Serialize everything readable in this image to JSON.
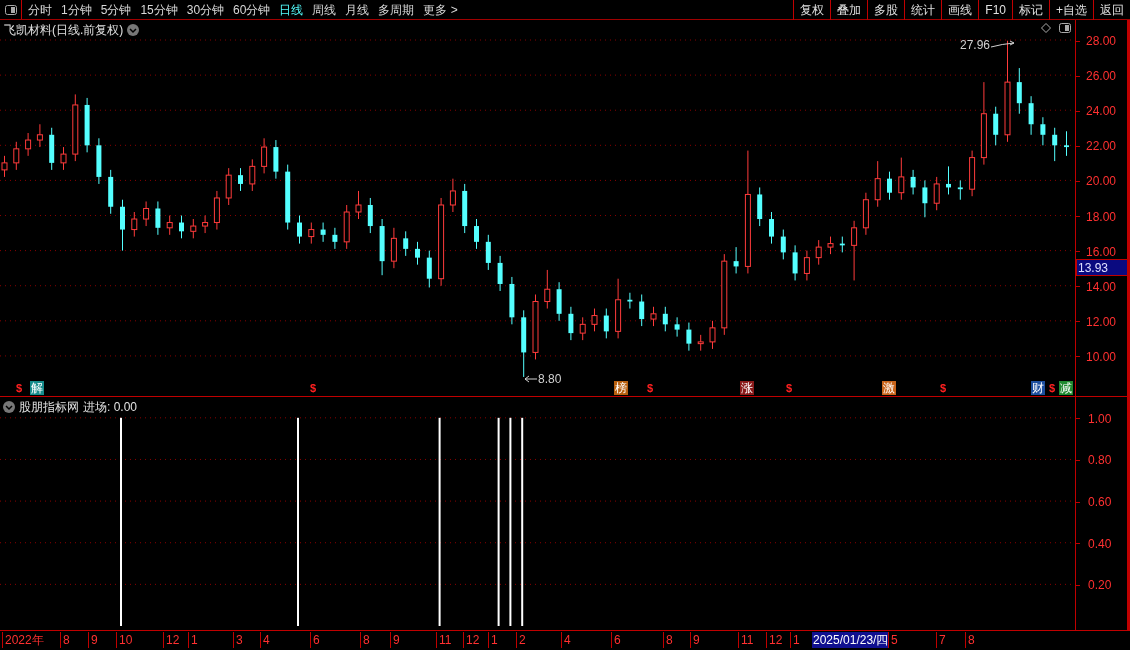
{
  "toolbar": {
    "period_tabs": [
      {
        "label": "分时",
        "selected": false
      },
      {
        "label": "1分钟",
        "selected": false
      },
      {
        "label": "5分钟",
        "selected": false
      },
      {
        "label": "15分钟",
        "selected": false
      },
      {
        "label": "30分钟",
        "selected": false
      },
      {
        "label": "60分钟",
        "selected": false
      },
      {
        "label": "日线",
        "selected": true
      },
      {
        "label": "周线",
        "selected": false
      },
      {
        "label": "月线",
        "selected": false
      },
      {
        "label": "多周期",
        "selected": false
      },
      {
        "label": "更多 >",
        "selected": false
      }
    ],
    "actions": [
      "复权",
      "叠加",
      "多股",
      "统计",
      "画线",
      "F10",
      "标记",
      "+自选",
      "返回"
    ]
  },
  "price_chart": {
    "title": "飞凯材料(日线.前复权)",
    "current_price": "13.93",
    "high_label": "27.96",
    "low_label": "8.80",
    "chart_data": {
      "type": "candlestick",
      "ylim": [
        7.66,
        29.14
      ],
      "grid": true,
      "yticks": [
        {
          "value": 28,
          "label": "28.00"
        },
        {
          "value": 26,
          "label": "26.00"
        },
        {
          "value": 24,
          "label": "24.00"
        },
        {
          "value": 22,
          "label": "22.00"
        },
        {
          "value": 20,
          "label": "20.00"
        },
        {
          "value": 18,
          "label": "18.00"
        },
        {
          "value": 16,
          "label": "16.00"
        },
        {
          "value": 14,
          "label": "14.00"
        },
        {
          "value": 12,
          "label": "12.00"
        },
        {
          "value": 10,
          "label": "10.00"
        }
      ],
      "ohlc": [
        [
          20.6,
          21.4,
          20.2,
          21.0
        ],
        [
          21.0,
          22.2,
          20.6,
          21.8
        ],
        [
          21.8,
          22.7,
          21.4,
          22.3
        ],
        [
          22.3,
          23.2,
          21.9,
          22.6
        ],
        [
          22.6,
          23.0,
          20.6,
          21.0
        ],
        [
          21.0,
          21.9,
          20.6,
          21.5
        ],
        [
          21.5,
          24.9,
          21.1,
          24.3
        ],
        [
          24.3,
          24.7,
          21.6,
          22.0
        ],
        [
          22.0,
          22.4,
          19.8,
          20.2
        ],
        [
          20.2,
          20.6,
          18.1,
          18.5
        ],
        [
          18.5,
          18.9,
          16.0,
          17.2
        ],
        [
          17.2,
          18.2,
          16.8,
          17.8
        ],
        [
          17.8,
          18.8,
          17.4,
          18.4
        ],
        [
          18.4,
          18.8,
          16.9,
          17.3
        ],
        [
          17.3,
          18.0,
          16.9,
          17.6
        ],
        [
          17.6,
          18.0,
          16.7,
          17.1
        ],
        [
          17.1,
          17.8,
          16.7,
          17.4
        ],
        [
          17.4,
          18.0,
          17.0,
          17.6
        ],
        [
          17.6,
          19.4,
          17.2,
          19.0
        ],
        [
          19.0,
          20.7,
          18.6,
          20.3
        ],
        [
          20.3,
          20.7,
          19.4,
          19.8
        ],
        [
          19.8,
          21.2,
          19.4,
          20.8
        ],
        [
          20.8,
          22.4,
          20.4,
          21.9
        ],
        [
          21.9,
          22.3,
          20.1,
          20.5
        ],
        [
          20.5,
          20.9,
          17.2,
          17.6
        ],
        [
          17.6,
          18.0,
          16.4,
          16.8
        ],
        [
          16.8,
          17.6,
          16.4,
          17.2
        ],
        [
          17.2,
          17.6,
          16.5,
          16.9
        ],
        [
          16.9,
          17.3,
          16.1,
          16.5
        ],
        [
          16.5,
          18.6,
          16.1,
          18.2
        ],
        [
          18.2,
          19.4,
          17.8,
          18.6
        ],
        [
          18.6,
          19.0,
          17.0,
          17.4
        ],
        [
          17.4,
          17.8,
          14.6,
          15.4
        ],
        [
          15.4,
          17.3,
          15.0,
          16.7
        ],
        [
          16.7,
          17.1,
          15.7,
          16.1
        ],
        [
          16.1,
          16.5,
          15.2,
          15.6
        ],
        [
          15.6,
          16.0,
          13.9,
          14.4
        ],
        [
          14.4,
          19.0,
          14.0,
          18.6
        ],
        [
          18.6,
          20.1,
          18.2,
          19.4
        ],
        [
          19.4,
          19.8,
          17.0,
          17.4
        ],
        [
          17.4,
          17.8,
          16.1,
          16.5
        ],
        [
          16.5,
          16.9,
          14.9,
          15.3
        ],
        [
          15.3,
          15.7,
          13.7,
          14.1
        ],
        [
          14.1,
          14.5,
          11.8,
          12.2
        ],
        [
          12.2,
          12.6,
          8.8,
          10.2
        ],
        [
          10.2,
          13.5,
          9.8,
          13.1
        ],
        [
          13.1,
          14.9,
          12.7,
          13.8
        ],
        [
          13.8,
          14.2,
          12.0,
          12.4
        ],
        [
          12.4,
          12.8,
          10.9,
          11.3
        ],
        [
          11.3,
          12.2,
          10.9,
          11.8
        ],
        [
          11.8,
          12.7,
          11.4,
          12.3
        ],
        [
          12.3,
          12.7,
          11.0,
          11.4
        ],
        [
          11.4,
          14.4,
          11.0,
          13.2
        ],
        [
          13.2,
          13.6,
          12.7,
          13.1
        ],
        [
          13.1,
          13.5,
          11.7,
          12.1
        ],
        [
          12.1,
          12.8,
          11.7,
          12.4
        ],
        [
          12.4,
          12.8,
          11.4,
          11.8
        ],
        [
          11.8,
          12.2,
          11.1,
          11.5
        ],
        [
          11.5,
          11.9,
          10.3,
          10.7
        ],
        [
          10.7,
          11.2,
          10.3,
          10.8
        ],
        [
          10.8,
          12.0,
          10.4,
          11.6
        ],
        [
          11.6,
          15.8,
          11.2,
          15.4
        ],
        [
          15.4,
          16.2,
          14.7,
          15.1
        ],
        [
          15.1,
          21.7,
          14.7,
          19.2
        ],
        [
          19.2,
          19.6,
          17.4,
          17.8
        ],
        [
          17.8,
          18.2,
          16.4,
          16.8
        ],
        [
          16.8,
          17.2,
          15.5,
          15.9
        ],
        [
          15.9,
          16.3,
          14.3,
          14.7
        ],
        [
          14.7,
          16.0,
          14.3,
          15.6
        ],
        [
          15.6,
          16.6,
          15.2,
          16.2
        ],
        [
          16.2,
          16.8,
          15.8,
          16.4
        ],
        [
          16.4,
          16.8,
          15.9,
          16.3
        ],
        [
          16.3,
          17.7,
          14.3,
          17.3
        ],
        [
          17.3,
          19.3,
          16.9,
          18.9
        ],
        [
          18.9,
          21.1,
          18.5,
          20.1
        ],
        [
          20.1,
          20.5,
          18.9,
          19.3
        ],
        [
          19.3,
          21.3,
          18.9,
          20.2
        ],
        [
          20.2,
          20.6,
          19.2,
          19.6
        ],
        [
          19.6,
          20.0,
          17.9,
          18.7
        ],
        [
          18.7,
          20.2,
          18.3,
          19.8
        ],
        [
          19.8,
          20.8,
          19.2,
          19.6
        ],
        [
          19.6,
          20.0,
          18.9,
          19.5
        ],
        [
          19.5,
          21.7,
          19.1,
          21.3
        ],
        [
          21.3,
          25.6,
          20.9,
          23.8
        ],
        [
          23.8,
          24.2,
          22.0,
          22.6
        ],
        [
          22.6,
          27.96,
          22.2,
          25.6
        ],
        [
          25.6,
          26.4,
          23.8,
          24.4
        ],
        [
          24.4,
          24.8,
          22.6,
          23.2
        ],
        [
          23.2,
          23.6,
          22.0,
          22.6
        ],
        [
          22.6,
          23.0,
          21.1,
          22.0
        ],
        [
          22.0,
          22.8,
          21.4,
          21.9
        ]
      ]
    },
    "markers": [
      {
        "kind": "dollar",
        "text": "$"
      },
      {
        "kind": "badge",
        "text": "解",
        "color": "#178c8c"
      },
      {
        "kind": "dollar",
        "text": "$"
      },
      {
        "kind": "badge",
        "text": "榜",
        "color": "#b8600f"
      },
      {
        "kind": "dollar",
        "text": "$"
      },
      {
        "kind": "badge",
        "text": "涨",
        "color": "#8a1a1a"
      },
      {
        "kind": "dollar",
        "text": "$"
      },
      {
        "kind": "badge",
        "text": "激",
        "color": "#c8641a"
      },
      {
        "kind": "dollar",
        "text": "$"
      },
      {
        "kind": "badge",
        "text": "财",
        "color": "#1d4e9e"
      },
      {
        "kind": "dollar",
        "text": "$"
      },
      {
        "kind": "badge",
        "text": "减",
        "color": "#1f8a2f"
      }
    ]
  },
  "indicator": {
    "name": "股朋指标网",
    "reading": "进场: 0.00",
    "chart_data": {
      "type": "bar",
      "ylim": [
        0,
        1.1
      ],
      "grid": true,
      "values": [
        0,
        0,
        0,
        0,
        0,
        0,
        0,
        0,
        0,
        0,
        1,
        0,
        0,
        0,
        0,
        0,
        0,
        0,
        0,
        0,
        0,
        0,
        0,
        0,
        0,
        1,
        0,
        0,
        0,
        0,
        0,
        0,
        0,
        0,
        0,
        0,
        0,
        1,
        0,
        0,
        0,
        0,
        1,
        1,
        1,
        0,
        0,
        0,
        0,
        0,
        0,
        0,
        0,
        0,
        0,
        0,
        0,
        0,
        0,
        0,
        0,
        0,
        0,
        0,
        0,
        0,
        0,
        0,
        0,
        0,
        0,
        0,
        0,
        0,
        0,
        0,
        0,
        0,
        0,
        0,
        0,
        0,
        0,
        0,
        0,
        0,
        0,
        0,
        0,
        0,
        0
      ],
      "yticks": [
        {
          "value": 1,
          "label": "1.00"
        },
        {
          "value": 0.8,
          "label": "0.80"
        },
        {
          "value": 0.6,
          "label": "0.60"
        },
        {
          "value": 0.4,
          "label": "0.40"
        },
        {
          "value": 0.2,
          "label": "0.20"
        }
      ]
    }
  },
  "time_axis": {
    "labels": [
      {
        "kind": "tick",
        "text": "2022年"
      },
      {
        "kind": "tick",
        "text": "8"
      },
      {
        "kind": "tick",
        "text": "9"
      },
      {
        "kind": "tick",
        "text": "10"
      },
      {
        "kind": "tick",
        "text": "12"
      },
      {
        "kind": "tick",
        "text": "1"
      },
      {
        "kind": "tick",
        "text": "3"
      },
      {
        "kind": "tick",
        "text": "4"
      },
      {
        "kind": "tick",
        "text": "6"
      },
      {
        "kind": "tick",
        "text": "8"
      },
      {
        "kind": "tick",
        "text": "9"
      },
      {
        "kind": "tick",
        "text": "11"
      },
      {
        "kind": "tick",
        "text": "12"
      },
      {
        "kind": "tick",
        "text": "1"
      },
      {
        "kind": "tick",
        "text": "2"
      },
      {
        "kind": "tick",
        "text": "4"
      },
      {
        "kind": "tick",
        "text": "6"
      },
      {
        "kind": "tick",
        "text": "8"
      },
      {
        "kind": "tick",
        "text": "9"
      },
      {
        "kind": "tick",
        "text": "11"
      },
      {
        "kind": "tick",
        "text": "12"
      },
      {
        "kind": "tick",
        "text": "1"
      },
      {
        "kind": "cursor",
        "text": "2025/01/23/四"
      },
      {
        "kind": "tick",
        "text": "5"
      },
      {
        "kind": "tick",
        "text": "7"
      },
      {
        "kind": "tick",
        "text": "8"
      }
    ]
  }
}
